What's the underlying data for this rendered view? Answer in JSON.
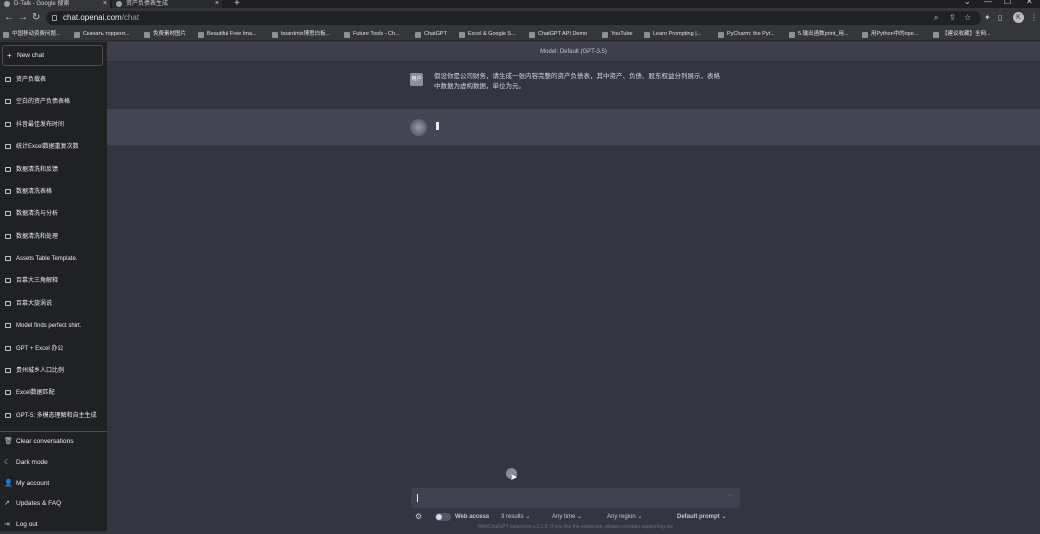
{
  "browser": {
    "tabs": [
      {
        "title": "D-Talk - Google 搜索",
        "active": true
      },
      {
        "title": "资产负债表生成",
        "active": false
      }
    ],
    "new_tab_icon": "+",
    "window_controls": [
      "⌄",
      "—",
      "☐",
      "✕"
    ],
    "url_host": "chat.openai.com",
    "url_path": "/chat",
    "profile_initial": "K",
    "bookmarks": [
      "中国移动资费问题...",
      "Скачать торрент...",
      "免费素材图片",
      "Beautiful Free Ima...",
      "boardmix博思白板...",
      "Future Tools - Ch...",
      "ChatGPT",
      "Excel & Google S...",
      "ChatGPT API Demo",
      "YouTube",
      "Learn Prompting |...",
      "PyCharm: the Pyt...",
      "5.输出函数print_用...",
      "用Python中的ope...",
      "【建议收藏】全网..."
    ]
  },
  "sidebar": {
    "new_chat": "New chat",
    "conversations": [
      "资产负载表",
      "空白的资产负债表格",
      "抖音最佳发布时间",
      "统计Excel数据重复次数",
      "数据清洗和反馈",
      "数据清洗表格",
      "数据清洗与分析",
      "数据清洗和处理",
      "Assets Table Template.",
      "百慕大三角解释",
      "百慕大旋涡说",
      "Model finds perfect shirt.",
      "GPT + Excel 办公",
      "贵州城乡人口比例",
      "Excel数据匹配",
      "GPT-5: 多模态理解和自主生成"
    ],
    "footer": [
      {
        "label": "Clear conversations",
        "icon": "trash-icon",
        "glyph": "🗑"
      },
      {
        "label": "Dark mode",
        "icon": "moon-icon",
        "glyph": "☾"
      },
      {
        "label": "My account",
        "icon": "user-icon",
        "glyph": "👤"
      },
      {
        "label": "Updates & FAQ",
        "icon": "external-link-icon",
        "glyph": "↗"
      },
      {
        "label": "Log out",
        "icon": "logout-icon",
        "glyph": "⇥"
      }
    ]
  },
  "main": {
    "model_label": "Model: Default (GPT-3.5)",
    "user_avatar_text": "用户",
    "user_message": "假设你是公司财务，请生成一张内容完整的资产负债表，其中资产、负债、股东权益分列展示，表格中数据为虚构数据，单位为元。",
    "input_more": "···",
    "web_access_label": "Web access",
    "web_access_on": false,
    "results_select": "3 results",
    "time_select": "Any time",
    "region_select": "Any region",
    "prompt_select": "Default prompt",
    "footnote": "WebChatGPT extension v.3.1.5. If you like the extension, please consider supporting me"
  },
  "colors": {
    "sidebar_bg": "#202123",
    "main_bg": "#343541",
    "assistant_row_bg": "#444654",
    "input_bg": "#40414f"
  }
}
